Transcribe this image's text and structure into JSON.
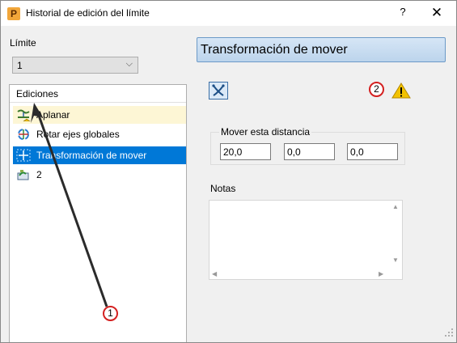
{
  "window": {
    "title": "Historial de edición del límite",
    "app_icon_letter": "P",
    "help_label": "?",
    "close_label": "✕"
  },
  "limit": {
    "label": "Límite",
    "selected": "1"
  },
  "edits": {
    "header": "Ediciones",
    "items": [
      {
        "label": "Aplanar",
        "icon": "flatten-icon",
        "state": "highlighted"
      },
      {
        "label": "Rotar ejes globales",
        "icon": "rotate-axes-icon",
        "state": "normal"
      },
      {
        "label": "Transformación de mover",
        "icon": "move-transform-icon",
        "state": "selected"
      },
      {
        "label": "2",
        "icon": "boundary-icon",
        "state": "normal"
      }
    ]
  },
  "detail": {
    "heading": "Transformación de mover",
    "tool_icon": "move-tool-icon",
    "warning_icon": "warning-icon",
    "distance": {
      "label": "Mover esta distancia",
      "x": "20,0",
      "y": "0,0",
      "z": "0,0"
    },
    "notes": {
      "label": "Notas",
      "value": ""
    }
  },
  "callouts": {
    "one": "1",
    "two": "2"
  },
  "colors": {
    "selection": "#0078d7",
    "highlight_row": "#fdf6d5",
    "heading_bar": "#c7dcf0",
    "callout_ring": "#d42020",
    "warning": "#f2c200"
  }
}
